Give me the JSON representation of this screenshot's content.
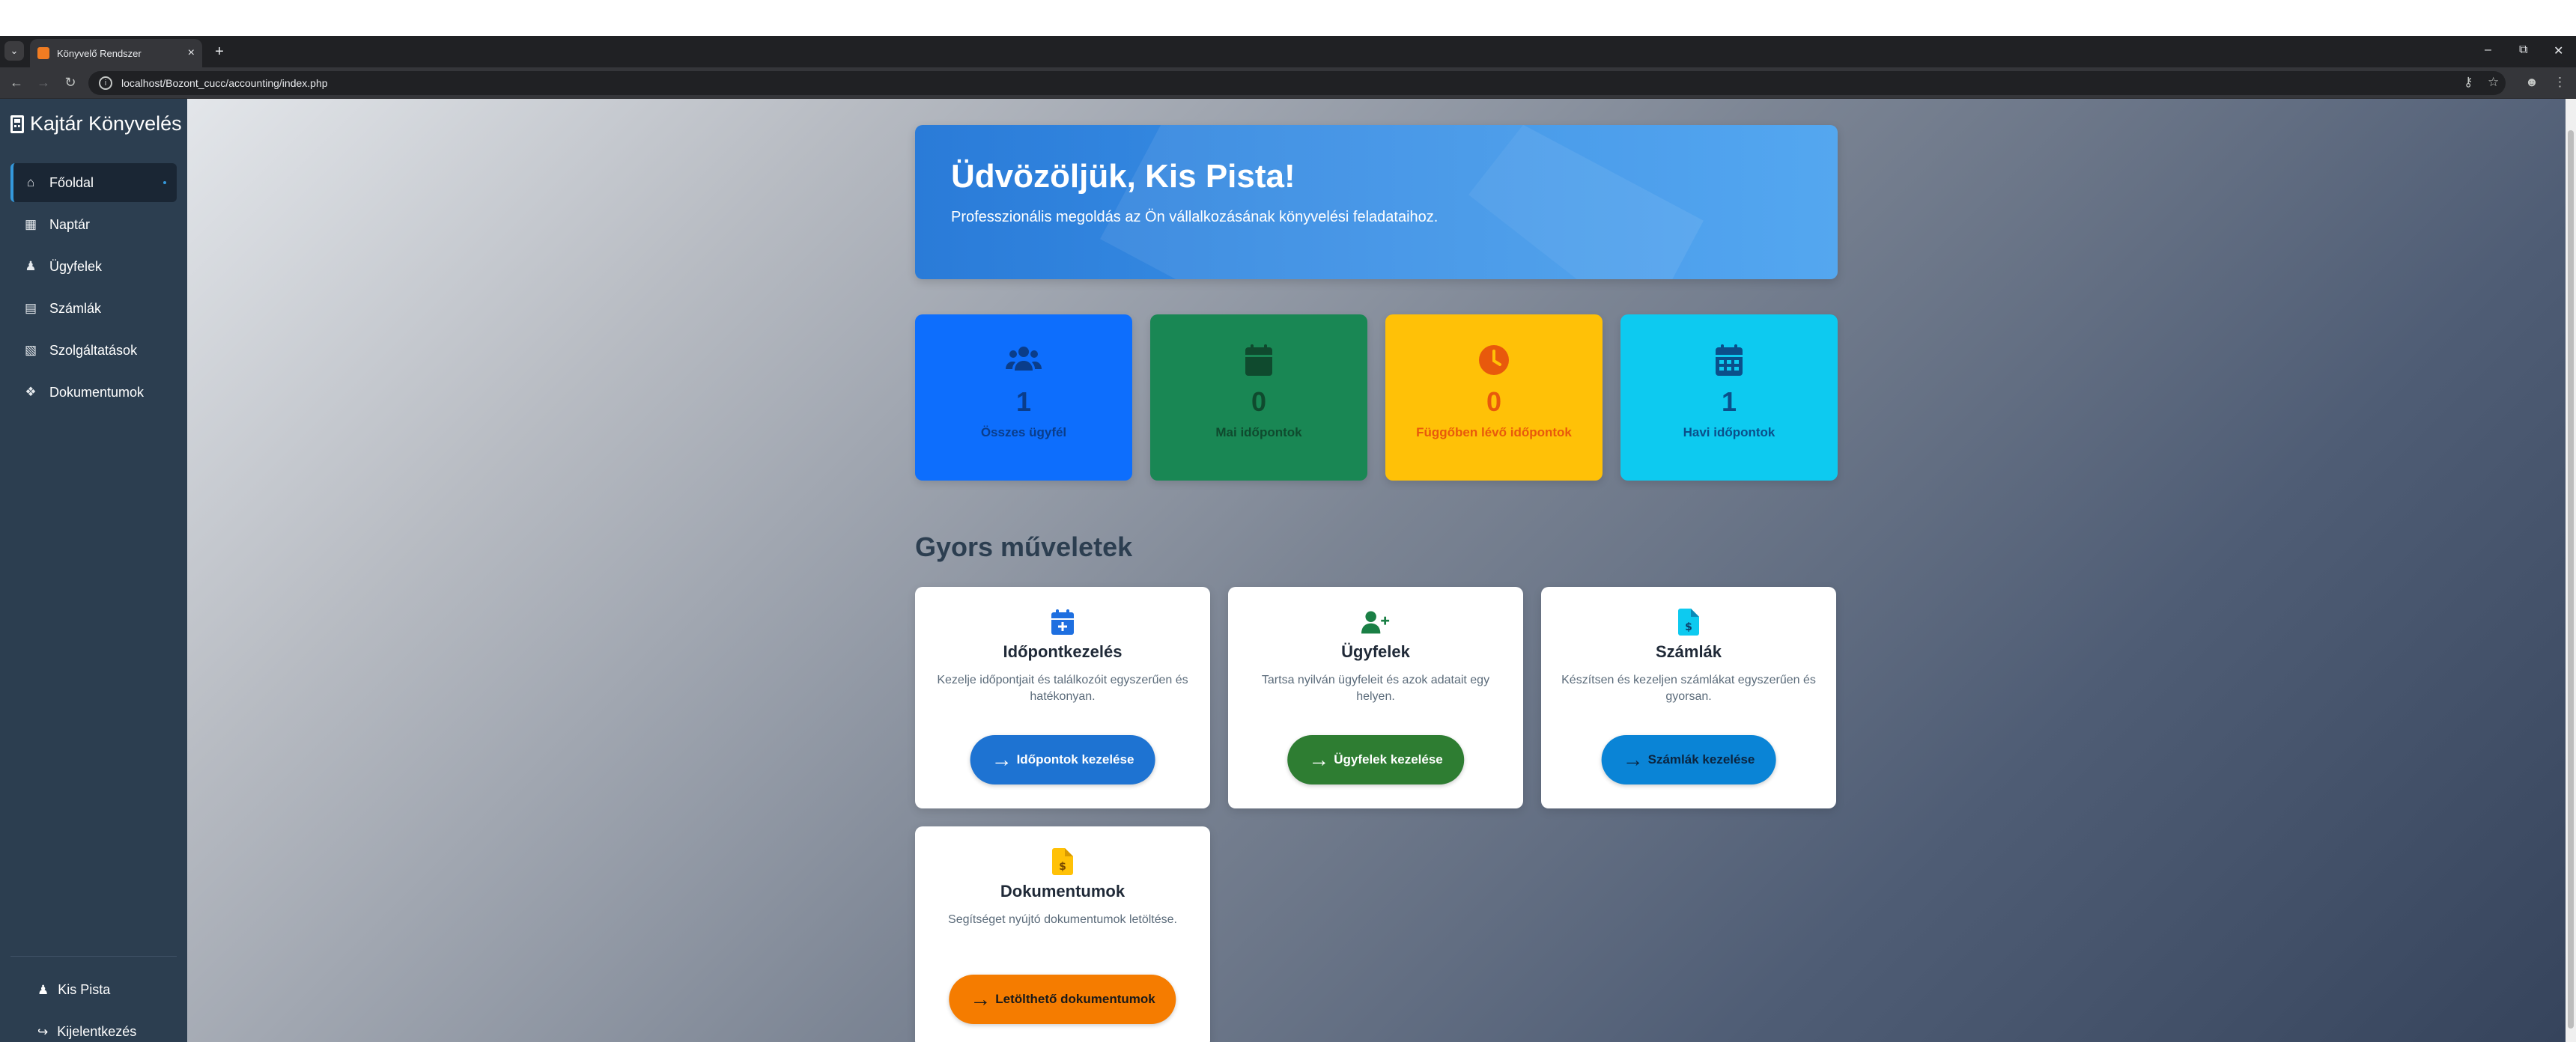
{
  "browser": {
    "tab_title": "Könyvelő Rendszer",
    "url": "localhost/Bozont_cucc/accounting/index.php"
  },
  "sidebar": {
    "brand": "Kajtár Könyvelés",
    "items": [
      {
        "label": "Főoldal",
        "icon": "home-icon",
        "active": true
      },
      {
        "label": "Naptár",
        "icon": "calendar-icon"
      },
      {
        "label": "Ügyfelek",
        "icon": "users-icon"
      },
      {
        "label": "Számlák",
        "icon": "invoice-icon"
      },
      {
        "label": "Szolgáltatások",
        "icon": "services-icon"
      },
      {
        "label": "Dokumentumok",
        "icon": "documents-icon"
      }
    ],
    "user": "Kis Pista",
    "logout": "Kijelentkezés"
  },
  "hero": {
    "title": "Üdvözöljük, Kis Pista!",
    "subtitle": "Professzionális megoldás az Ön vállalkozásának könyvelési feladataihoz."
  },
  "stats": [
    {
      "value": "1",
      "label": "Összes ügyfél",
      "color": "#0d6efd",
      "text_color": "#0a3d8a",
      "icon": "users-icon"
    },
    {
      "value": "0",
      "label": "Mai időpontok",
      "color": "#198754",
      "text_color": "#0f4a2e",
      "icon": "calendar-icon"
    },
    {
      "value": "0",
      "label": "Függőben lévő időpontok",
      "color": "#ffc107",
      "text_color": "#e8590c",
      "icon": "clock-icon"
    },
    {
      "value": "1",
      "label": "Havi időpontok",
      "color": "#0dcaf0",
      "text_color": "#0b4f8a",
      "icon": "calendar-icon"
    }
  ],
  "quick_actions": {
    "title": "Gyors műveletek",
    "cards": [
      {
        "title": "Időpontkezelés",
        "description": "Kezelje időpontjait és találkozóit egyszerűen és hatékonyan.",
        "button": "Időpontok kezelése",
        "button_color": "#1e73d2",
        "icon": "calendar-plus-icon"
      },
      {
        "title": "Ügyfelek",
        "description": "Tartsa nyilván ügyfeleit és azok adatait egy helyen.",
        "button": "Ügyfelek kezelése",
        "button_color": "#2e7d32",
        "icon": "user-plus-icon"
      },
      {
        "title": "Számlák",
        "description": "Készítsen és kezeljen számlákat egyszerűen és gyorsan.",
        "button": "Számlák kezelése",
        "button_color": "#0a84d6",
        "icon": "invoice-dollar-icon"
      },
      {
        "title": "Dokumentumok",
        "description": "Segítséget nyújtó dokumentumok letöltése.",
        "button": "Letölthető dokumentumok",
        "button_color": "#f57c00",
        "icon": "document-dollar-icon"
      }
    ]
  }
}
